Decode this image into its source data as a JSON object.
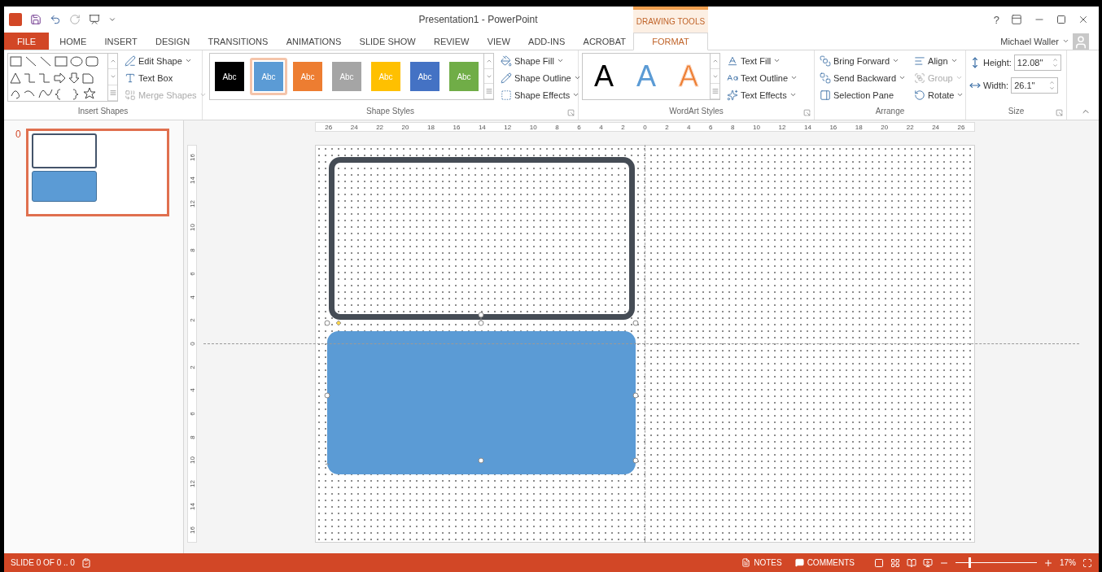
{
  "title_bar": {
    "title": "Presentation1 - PowerPoint",
    "context_label": "DRAWING TOOLS",
    "help": "?"
  },
  "tabs": [
    {
      "label": "FILE",
      "kind": "file",
      "selected": false
    },
    {
      "label": "HOME",
      "kind": "tab",
      "selected": false
    },
    {
      "label": "INSERT",
      "kind": "tab",
      "selected": false
    },
    {
      "label": "DESIGN",
      "kind": "tab",
      "selected": false
    },
    {
      "label": "TRANSITIONS",
      "kind": "tab",
      "selected": false
    },
    {
      "label": "ANIMATIONS",
      "kind": "tab",
      "selected": false
    },
    {
      "label": "SLIDE SHOW",
      "kind": "tab",
      "selected": false
    },
    {
      "label": "REVIEW",
      "kind": "tab",
      "selected": false
    },
    {
      "label": "VIEW",
      "kind": "tab",
      "selected": false
    },
    {
      "label": "ADD-INS",
      "kind": "tab",
      "selected": false
    },
    {
      "label": "ACROBAT",
      "kind": "tab",
      "selected": false
    },
    {
      "label": "FORMAT",
      "kind": "context",
      "selected": true
    }
  ],
  "user": {
    "name": "Michael Waller"
  },
  "ribbon": {
    "insert_shapes": {
      "label": "Insert Shapes",
      "commands": [
        {
          "label": "Edit Shape",
          "dropdown": true,
          "disabled": false
        },
        {
          "label": "Text Box",
          "dropdown": false,
          "disabled": false
        },
        {
          "label": "Merge Shapes",
          "dropdown": true,
          "disabled": true
        }
      ]
    },
    "shape_styles": {
      "label": "Shape Styles",
      "swatches": [
        {
          "label": "Abc",
          "color": "#000000",
          "selected": false
        },
        {
          "label": "Abc",
          "color": "#5b9bd5",
          "selected": true
        },
        {
          "label": "Abc",
          "color": "#ed7d31",
          "selected": false
        },
        {
          "label": "Abc",
          "color": "#a5a5a5",
          "selected": false
        },
        {
          "label": "Abc",
          "color": "#ffc000",
          "selected": false
        },
        {
          "label": "Abc",
          "color": "#4472c4",
          "selected": false
        },
        {
          "label": "Abc",
          "color": "#70ad47",
          "selected": false
        }
      ],
      "commands": [
        {
          "label": "Shape Fill",
          "dropdown": true,
          "disabled": false
        },
        {
          "label": "Shape Outline",
          "dropdown": true,
          "disabled": false
        },
        {
          "label": "Shape Effects",
          "dropdown": true,
          "disabled": false
        }
      ]
    },
    "wordart_styles": {
      "label": "WordArt Styles",
      "samples": [
        {
          "label": "A",
          "kind": "fill",
          "color": "#000000"
        },
        {
          "label": "A",
          "kind": "fill",
          "color": "#5b9bd5"
        },
        {
          "label": "A",
          "kind": "outline",
          "color": "#ed7d31"
        }
      ],
      "commands": [
        {
          "label": "Text Fill",
          "dropdown": true,
          "disabled": false
        },
        {
          "label": "Text Outline",
          "dropdown": true,
          "disabled": false
        },
        {
          "label": "Text Effects",
          "dropdown": true,
          "disabled": false
        }
      ]
    },
    "arrange": {
      "label": "Arrange",
      "commands": [
        {
          "label": "Bring Forward",
          "dropdown": true,
          "disabled": false
        },
        {
          "label": "Send Backward",
          "dropdown": true,
          "disabled": false
        },
        {
          "label": "Selection Pane",
          "dropdown": false,
          "disabled": false
        },
        {
          "label": "Align",
          "dropdown": true,
          "disabled": false
        },
        {
          "label": "Group",
          "dropdown": true,
          "disabled": true
        },
        {
          "label": "Rotate",
          "dropdown": true,
          "disabled": false
        }
      ]
    },
    "size": {
      "label": "Size",
      "fields": [
        {
          "label": "Height:",
          "value": "12.08\""
        },
        {
          "label": "Width:",
          "value": "26.1\""
        }
      ]
    }
  },
  "thumbnails": [
    {
      "number": "0",
      "selected": true
    }
  ],
  "rulers": {
    "horizontal": [
      "26",
      "24",
      "22",
      "20",
      "18",
      "16",
      "14",
      "12",
      "10",
      "8",
      "6",
      "4",
      "2",
      "0",
      "2",
      "4",
      "6",
      "8",
      "10",
      "12",
      "14",
      "16",
      "18",
      "20",
      "22",
      "24",
      "26"
    ],
    "vertical": [
      "16",
      "14",
      "12",
      "10",
      "8",
      "6",
      "4",
      "2",
      "0",
      "2",
      "4",
      "6",
      "8",
      "10",
      "12",
      "14",
      "16"
    ]
  },
  "status_bar": {
    "slide_info": "SLIDE 0 OF 0 .. 0",
    "notes": "NOTES",
    "comments": "COMMENTS",
    "zoom": {
      "level": 0.17,
      "value": "17%"
    }
  }
}
